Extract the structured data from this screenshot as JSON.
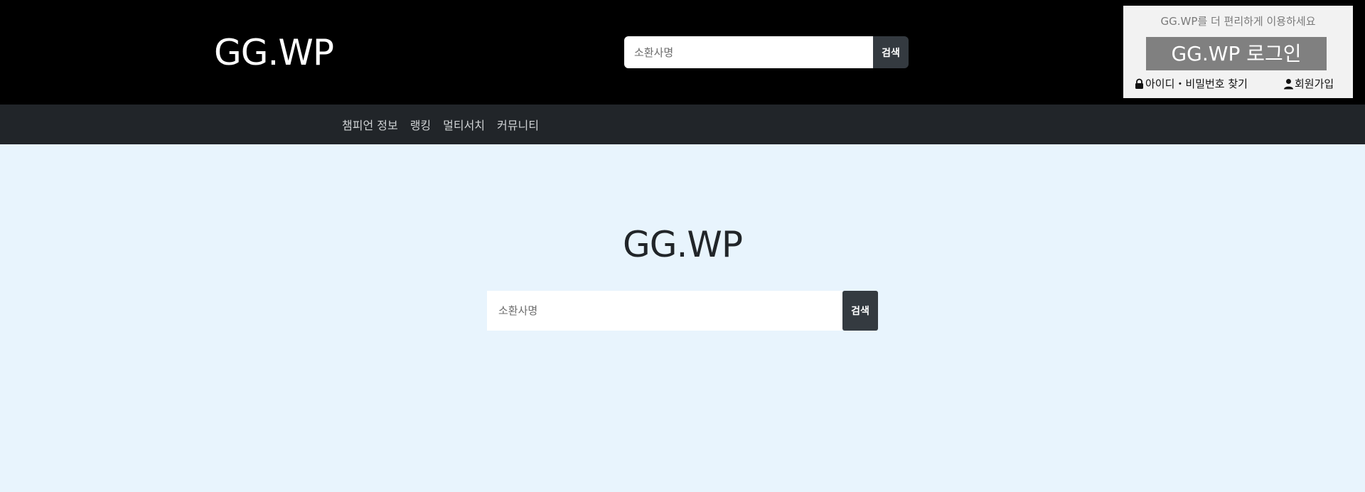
{
  "header": {
    "logo": "GG.WP",
    "search": {
      "placeholder": "소환사명",
      "button_label": "검색"
    }
  },
  "login_box": {
    "subtitle": "GG.WP를 더 편리하게 이용하세요",
    "login_button": "GG.WP 로그인",
    "find_account": {
      "icon": "lock-icon",
      "label": "아이디・비밀번호 찾기"
    },
    "signup": {
      "icon": "user-icon",
      "label": "회원가입"
    }
  },
  "nav": {
    "items": [
      {
        "label": "챔피언 정보"
      },
      {
        "label": "랭킹"
      },
      {
        "label": "멀티서치"
      },
      {
        "label": "커뮤니티"
      }
    ]
  },
  "main": {
    "title": "GG.WP",
    "search": {
      "placeholder": "소환사명",
      "button_label": "검색"
    }
  },
  "colors": {
    "header_bg": "#000000",
    "nav_bg": "#212529",
    "page_bg": "#e8f4fd",
    "search_button": "#343a40",
    "login_button": "#808080"
  }
}
